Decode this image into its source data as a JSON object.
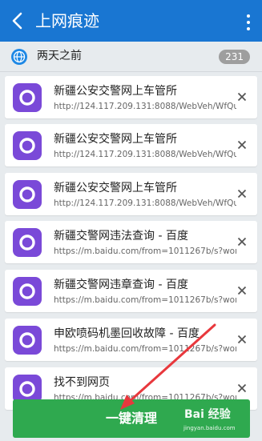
{
  "header": {
    "title": "上网痕迹",
    "back_icon": "chevron-left-icon",
    "menu_icon": "overflow-menu-icon"
  },
  "group": {
    "label": "两天之前",
    "count": "231",
    "icon": "globe-icon"
  },
  "items": [
    {
      "title": "新疆公安交警网上车管所",
      "url": "http://124.117.209.131:8088/WebVeh/WfQue"
    },
    {
      "title": "新疆公安交警网上车管所",
      "url": "http://124.117.209.131:8088/WebVeh/WfQue"
    },
    {
      "title": "新疆公安交警网上车管所",
      "url": "http://124.117.209.131:8088/WebVeh/WfQue"
    },
    {
      "title": "新疆交警网违法查询 - 百度",
      "url": "https://m.baidu.com/from=1011267b/s?wor"
    },
    {
      "title": "新疆交警网违章查询 - 百度",
      "url": "https://m.baidu.com/from=1011267b/s?wor"
    },
    {
      "title": "申欧喷码机墨回收故障 - 百度",
      "url": "https://m.baidu.com/from=1011267b/s?wor"
    },
    {
      "title": "找不到网页",
      "url": "https://m.baidu.com/from=1011267b/s?wor"
    }
  ],
  "bottom_button": {
    "label": "一键清理"
  },
  "watermark": {
    "logo": "Bai 经验",
    "url": "jingyan.baidu.com"
  },
  "colors": {
    "header": "#1976d2",
    "app_icon": "#7a49d8",
    "clean_button": "#2fa94f",
    "annotation_arrow": "#e8383d"
  }
}
